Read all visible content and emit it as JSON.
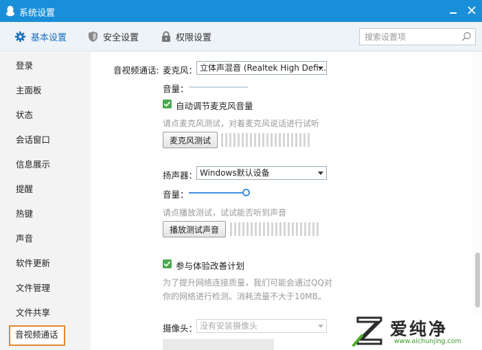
{
  "window": {
    "title": "系统设置"
  },
  "tabs": [
    {
      "label": "基本设置",
      "icon": "gear-icon",
      "active": true
    },
    {
      "label": "安全设置",
      "icon": "shield-icon"
    },
    {
      "label": "权限设置",
      "icon": "lock-icon"
    }
  ],
  "search": {
    "placeholder": "搜索设置项"
  },
  "sidebar": {
    "items": [
      "登录",
      "主面板",
      "状态",
      "会话窗口",
      "信息展示",
      "提醒",
      "热键",
      "声音",
      "软件更新",
      "文件管理",
      "文件共享",
      "音视频通话"
    ],
    "selected": "音视频通话"
  },
  "av": {
    "section_label": "音视频通话:",
    "mic": {
      "label": "麦克风：",
      "device": "立体声混音 (Realtek High Defi...",
      "volume_label": "音量：",
      "volume": 0,
      "auto_adjust_label": "自动调节麦克风音量",
      "auto_adjust_checked": true,
      "hint": "请点麦克风测试，对着麦克风说话进行试听",
      "test_button": "麦克风测试"
    },
    "speaker": {
      "label": "扬声器：",
      "device": "Windows默认设备",
      "volume_label": "音量：",
      "volume": 1.0,
      "hint": "请点播放测试，试试能否听到声音",
      "test_button": "播放测试声音"
    },
    "experience": {
      "label": "参与体验改善计划",
      "checked": true,
      "hint_line1": "为了提升网络连接质量，我们可能会通过QQ对",
      "hint_line2": "你的网络进行检测。消耗流量不大于10MB。"
    },
    "camera": {
      "label": "摄像头：",
      "device": "没有安装摄像头"
    }
  },
  "watermark": {
    "brand": "爱纯净",
    "url": "www.aichunjing.com"
  },
  "colors": {
    "titlebar": "#1a8fd9",
    "accent": "#3d8ede",
    "checkbox": "#4aa84e",
    "selected_outline": "#e0862e"
  }
}
